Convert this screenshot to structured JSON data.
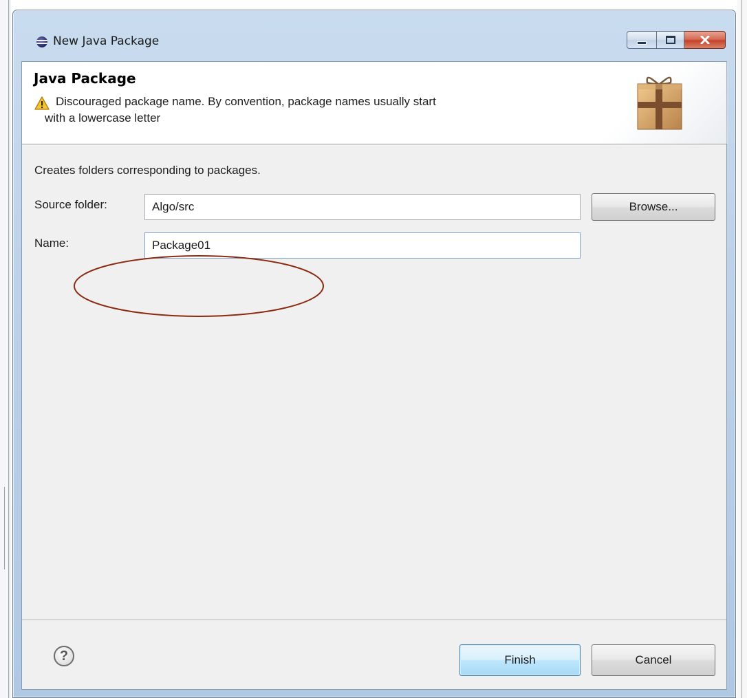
{
  "window": {
    "title": "New Java Package",
    "icon": "eclipse-icon",
    "controls": [
      "minimize-icon",
      "maximize-icon",
      "close-icon"
    ]
  },
  "header": {
    "title": "Java Package",
    "warning_icon": "warning-icon",
    "warning_line1": "Discouraged package name. By convention, package names usually start",
    "warning_line2": "with a lowercase letter",
    "banner_icon": "package-icon"
  },
  "body": {
    "description": "Creates folders corresponding to packages.",
    "source_folder_label": "Source folder:",
    "source_folder_value": "Algo/src",
    "browse_label": "Browse...",
    "name_label": "Name:",
    "name_value": "Package01"
  },
  "footer": {
    "help_icon": "help-icon",
    "finish_label": "Finish",
    "cancel_label": "Cancel"
  },
  "annotation": {
    "shape": "ellipse",
    "color": "#8b2a0e"
  }
}
